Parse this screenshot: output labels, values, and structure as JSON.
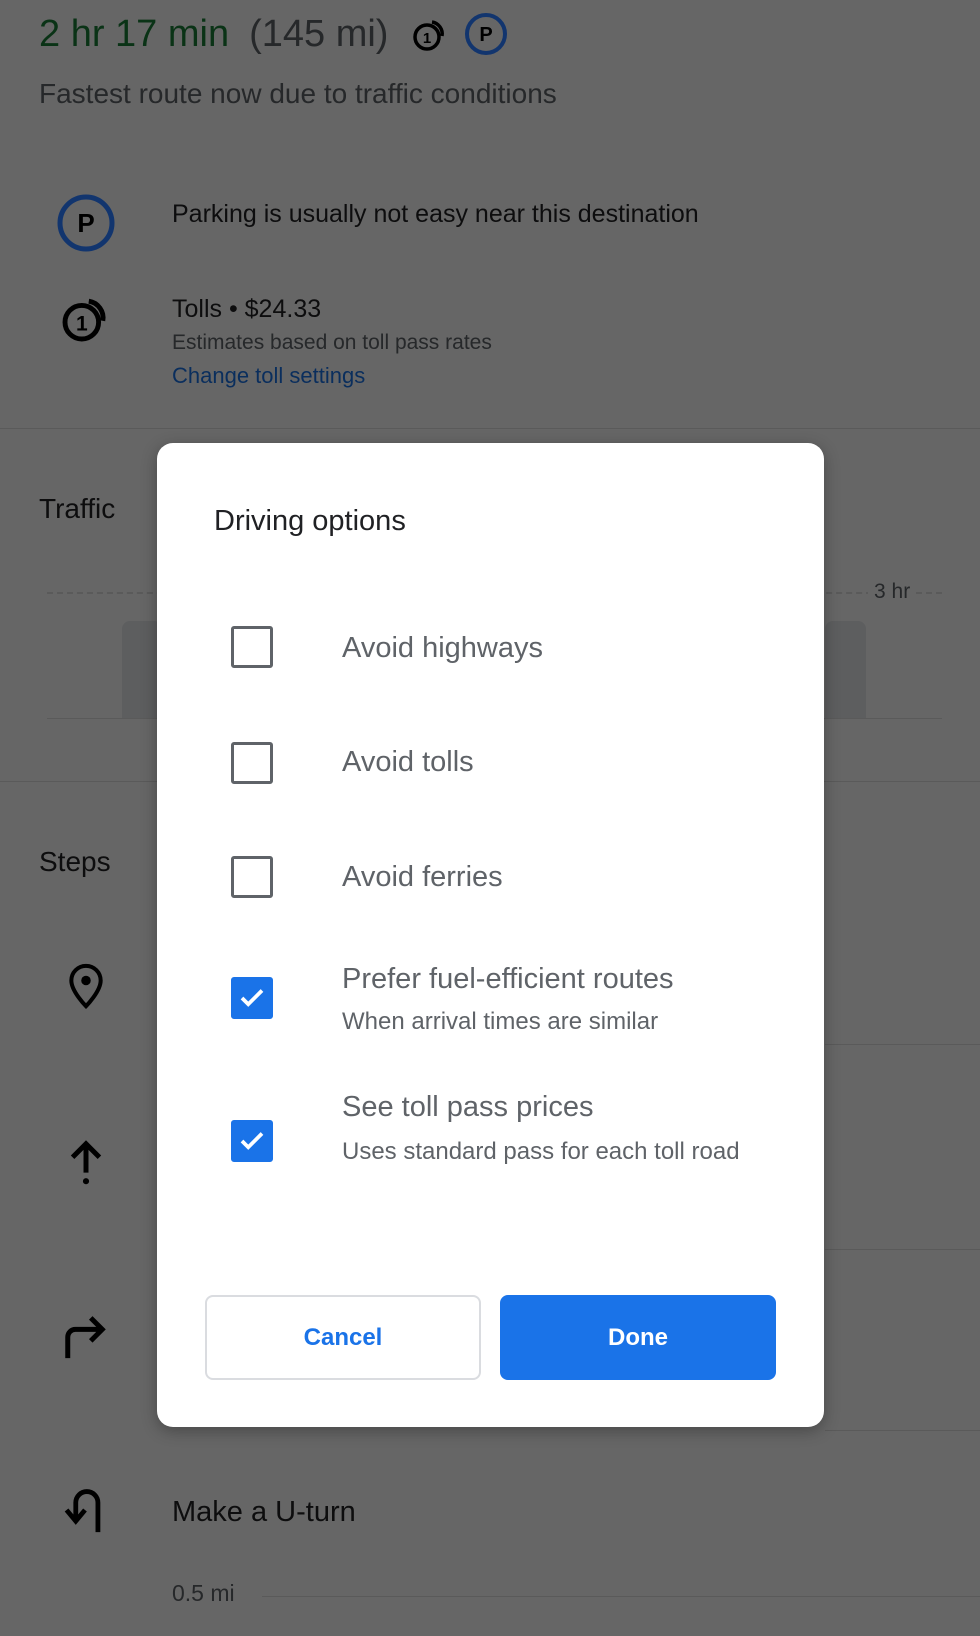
{
  "route": {
    "duration": "2 hr 17 min",
    "distance": "(145 mi)",
    "subtitle": "Fastest route now due to traffic conditions",
    "parking_note": "Parking is usually not easy near this destination",
    "tolls": "Tolls • $24.33",
    "tolls_note": "Estimates based on toll pass rates",
    "change_toll_link": "Change toll settings"
  },
  "traffic": {
    "label": "Traffic",
    "axis_label": "3 hr"
  },
  "steps": {
    "label": "Steps",
    "items": [
      {
        "icon": "location-pin-icon"
      },
      {
        "icon": "arrow-up-icon"
      },
      {
        "icon": "turn-right-icon"
      },
      {
        "icon": "u-turn-icon",
        "text": "Make a U-turn",
        "distance": "0.5 mi"
      }
    ]
  },
  "dialog": {
    "title": "Driving options",
    "options": [
      {
        "label": "Avoid highways",
        "checked": false
      },
      {
        "label": "Avoid tolls",
        "checked": false
      },
      {
        "label": "Avoid ferries",
        "checked": false
      },
      {
        "label": "Prefer fuel-efficient routes",
        "sublabel": "When arrival times are similar",
        "checked": true
      },
      {
        "label": "See toll pass prices",
        "sublabel": "Uses standard pass for each toll road",
        "checked": true
      }
    ],
    "cancel": "Cancel",
    "done": "Done"
  },
  "colors": {
    "accent": "#1a73e8",
    "duration_green": "#188038",
    "scrim": "#666666"
  }
}
